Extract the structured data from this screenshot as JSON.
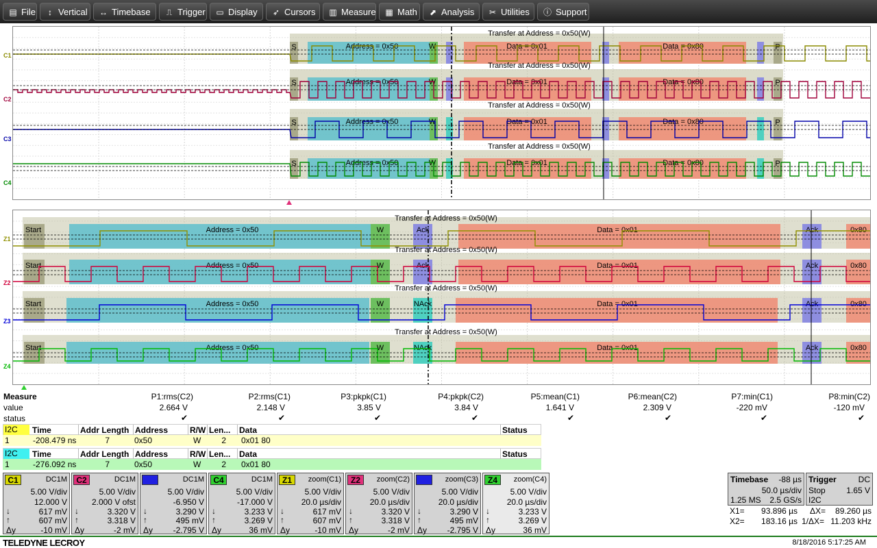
{
  "menu": [
    {
      "label": "File",
      "icon": "file-icon",
      "glyph": "▤"
    },
    {
      "label": "Vertical",
      "icon": "vertical-icon",
      "glyph": "↕"
    },
    {
      "label": "Timebase",
      "icon": "timebase-icon",
      "glyph": "↔"
    },
    {
      "label": "Trigger",
      "icon": "trigger-icon",
      "glyph": "⎍"
    },
    {
      "label": "Display",
      "icon": "display-icon",
      "glyph": "▭"
    },
    {
      "label": "Cursors",
      "icon": "cursors-icon",
      "glyph": "➶"
    },
    {
      "label": "Measure",
      "icon": "measure-icon",
      "glyph": "▥"
    },
    {
      "label": "Math",
      "icon": "math-icon",
      "glyph": "▦"
    },
    {
      "label": "Analysis",
      "icon": "analysis-icon",
      "glyph": "⬈"
    },
    {
      "label": "Utilities",
      "icon": "utilities-icon",
      "glyph": "✂"
    },
    {
      "label": "Support",
      "icon": "support-icon",
      "glyph": "ⓘ"
    }
  ],
  "colors": {
    "c1": "#8a8a00",
    "c2": "#a0003a",
    "c3": "#0000a8",
    "c4": "#008a00",
    "z1": "#909000",
    "z2": "#d0003a",
    "z3": "#0000d8",
    "z4": "#00b800",
    "addr": "#5fc0cc",
    "data": "#ee8f78",
    "wbox": "#6dbf5f",
    "ack": "#8e8ee0",
    "frame": "#bfbf9f"
  },
  "channels": {
    "top": [
      {
        "label": "C1"
      },
      {
        "label": "C2"
      },
      {
        "label": "C3"
      },
      {
        "label": "C4"
      }
    ],
    "zoom": [
      {
        "label": "Z1"
      },
      {
        "label": "Z2"
      },
      {
        "label": "Z3"
      },
      {
        "label": "Z4"
      }
    ]
  },
  "decode_top": {
    "transfer": "Transfer at Address = 0x50(W)",
    "start": "S",
    "address": "Address = 0x50",
    "rw": "W",
    "data1": "Data = 0x01",
    "data2": "Data = 0x80",
    "stop": "P"
  },
  "decode_zoom": {
    "transfer": "Transfer at Address = 0x50(W)",
    "start": "Start",
    "address": "Address = 0x50",
    "rw": "W",
    "ack": "Ack",
    "nack": "NAck",
    "data1": "Data = 0x01",
    "data2": "0x80"
  },
  "measure": {
    "title": "Measure",
    "row_labels": [
      "value",
      "status"
    ],
    "params": [
      {
        "name": "P1:rms(C2)",
        "value": "2.664 V"
      },
      {
        "name": "P2:rms(C1)",
        "value": "2.148 V"
      },
      {
        "name": "P3:pkpk(C1)",
        "value": "3.85 V"
      },
      {
        "name": "P4:pkpk(C2)",
        "value": "3.84 V"
      },
      {
        "name": "P5:mean(C1)",
        "value": "1.641 V"
      },
      {
        "name": "P6:mean(C2)",
        "value": "2.309 V"
      },
      {
        "name": "P7:min(C1)",
        "value": "-220 mV"
      },
      {
        "name": "P8:min(C2)",
        "value": "-120 mV"
      }
    ]
  },
  "decode_tables": [
    {
      "tag": "I2C",
      "tag_color": "#ffff40",
      "row_color": "#ffffc8",
      "headers": [
        "Time",
        "Addr Length",
        "Address",
        "R/W",
        "Len...",
        "Data",
        "Status"
      ],
      "row": [
        "1",
        "-208.479 ns",
        "7",
        "0x50",
        "W",
        "2",
        "0x01 80",
        ""
      ]
    },
    {
      "tag": "I2C",
      "tag_color": "#40f0f0",
      "row_color": "#b8f8b8",
      "headers": [
        "Time",
        "Addr Length",
        "Address",
        "R/W",
        "Len...",
        "Data",
        "Status"
      ],
      "row": [
        "1",
        "-276.092 ns",
        "7",
        "0x50",
        "W",
        "2",
        "0x01 80",
        ""
      ]
    }
  ],
  "tiles": [
    {
      "tag": "C1",
      "tag_color": "#d8d800",
      "coupling": "DC1M",
      "vdiv": "5.00 V/div",
      "offset": "12.000 V",
      "v1": "617 mV",
      "v2": "607 mV",
      "dy": "-10 mV"
    },
    {
      "tag": "C2",
      "tag_color": "#e0307a",
      "coupling": "DC1M",
      "vdiv": "5.00 V/div",
      "offset": "2.000 V ofst",
      "v1": "3.320 V",
      "v2": "3.318 V",
      "dy": "-2 mV"
    },
    {
      "tag": "C3",
      "tag_color": "#2020e0",
      "coupling": "DC1M",
      "vdiv": "5.00 V/div",
      "offset": "-6.950 V",
      "v1": "3.290 V",
      "v2": "495 mV",
      "dy": "-2.795 V"
    },
    {
      "tag": "C4",
      "tag_color": "#30d030",
      "coupling": "DC1M",
      "vdiv": "5.00 V/div",
      "offset": "-17.000 V",
      "v1": "3.233 V",
      "v2": "3.269 V",
      "dy": "36 mV"
    },
    {
      "tag": "Z1",
      "tag_color": "#d8d800",
      "coupling": "zoom(C1)",
      "vdiv": "5.00 V/div",
      "offset": "20.0 µs/div",
      "v1": "617 mV",
      "v2": "607 mV",
      "dy": "-10 mV"
    },
    {
      "tag": "Z2",
      "tag_color": "#e0307a",
      "coupling": "zoom(C2)",
      "vdiv": "5.00 V/div",
      "offset": "20.0 µs/div",
      "v1": "3.320 V",
      "v2": "3.318 V",
      "dy": "-2 mV"
    },
    {
      "tag": "Z3",
      "tag_color": "#2020e0",
      "coupling": "zoom(C3)",
      "vdiv": "5.00 V/div",
      "offset": "20.0 µs/div",
      "v1": "3.290 V",
      "v2": "495 mV",
      "dy": "-2.795 V"
    },
    {
      "tag": "Z4",
      "tag_color": "#30d030",
      "coupling": "zoom(C4)",
      "vdiv": "5.00 V/div",
      "offset": "20.0 µs/div",
      "v1": "3.233 V",
      "v2": "3.269 V",
      "dy": "36 mV"
    }
  ],
  "delta_label": "Δy",
  "timebase": {
    "label": "Timebase",
    "delay": "-88 µs",
    "tdiv": "50.0 µs/div",
    "samples": "1.25 MS",
    "rate": "2.5 GS/s"
  },
  "trigger": {
    "label": "Trigger",
    "coupling": "DC",
    "mode": "Stop",
    "level": "1.65 V",
    "type": "I2C"
  },
  "cursors": {
    "x1_label": "X1=",
    "x1": "93.896 µs",
    "dx_label": "ΔX=",
    "dx": "89.260 µs",
    "x2_label": "X2=",
    "x2": "183.16 µs",
    "inv_label": "1/ΔX=",
    "inv": "11.203 kHz"
  },
  "brand": "TELEDYNE LECROY",
  "datetime": "8/18/2016 5:17:25 AM"
}
